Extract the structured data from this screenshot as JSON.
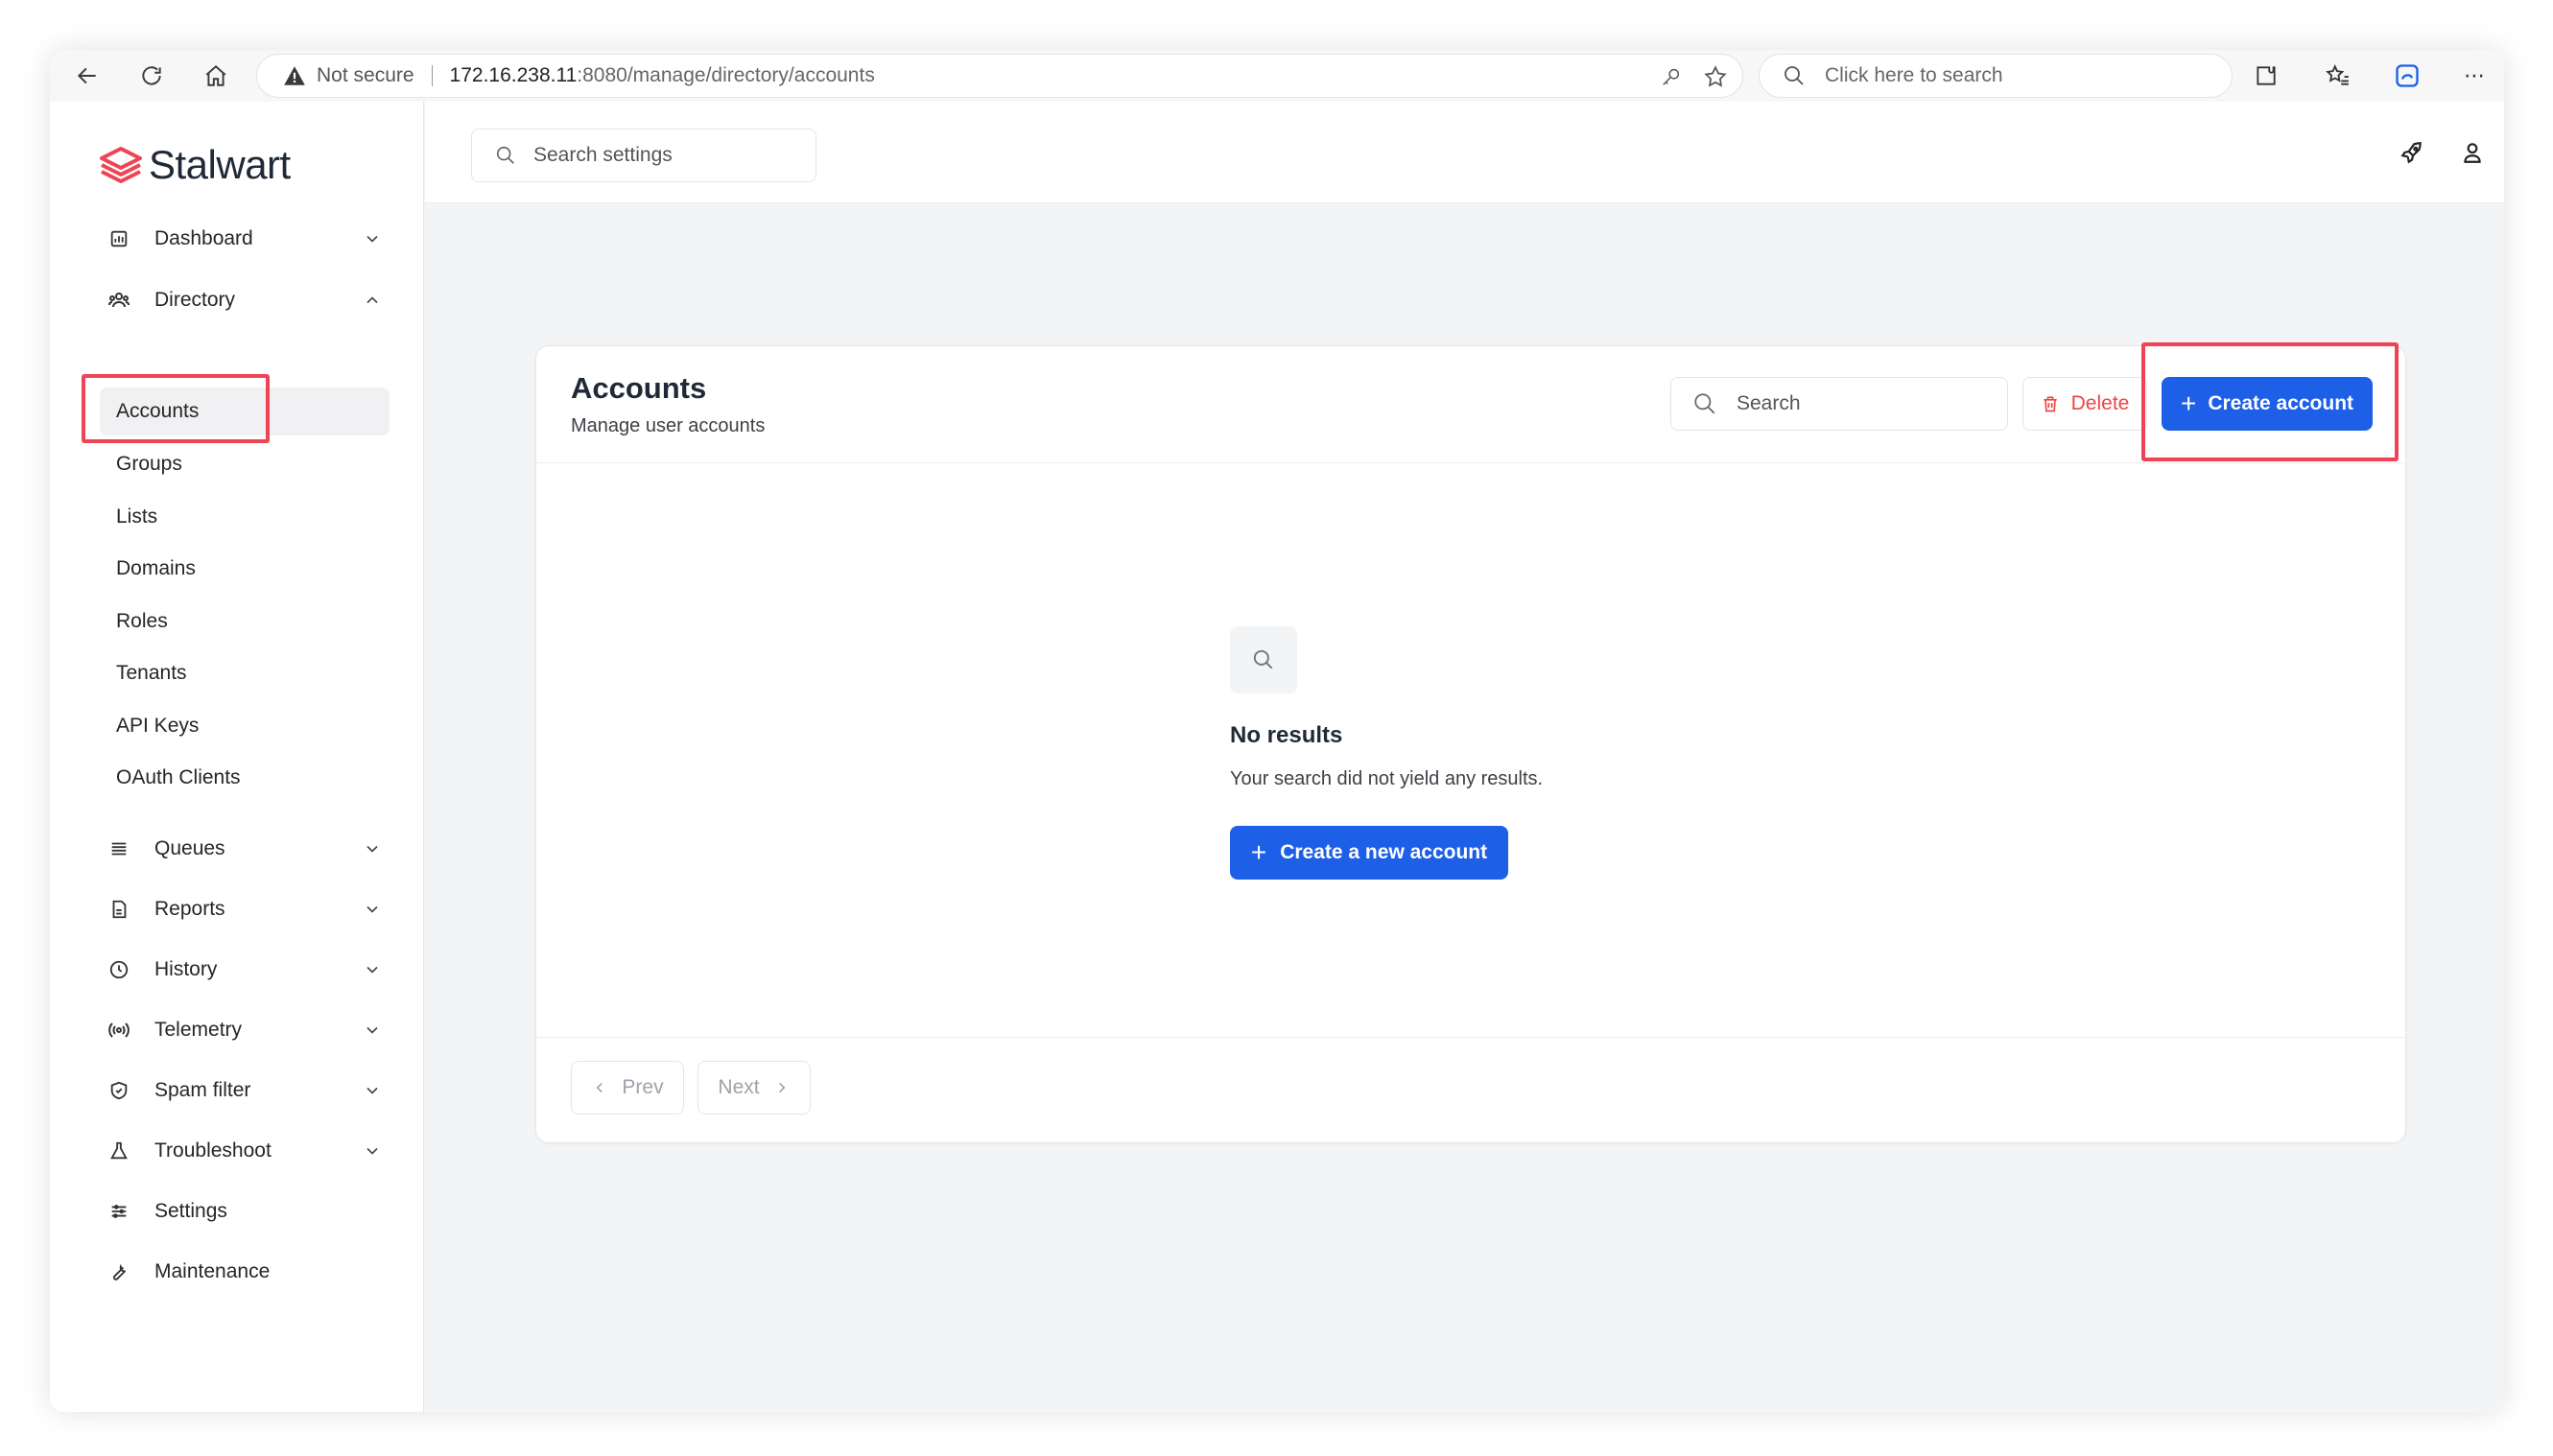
{
  "browser": {
    "security_label": "Not secure",
    "url_host": "172.16.238.11",
    "url_path": ":8080/manage/directory/accounts",
    "search_placeholder": "Click here to search"
  },
  "app": {
    "name": "Stalwart",
    "accent_color": "#ef4456",
    "primary_color": "#1d5fe6",
    "settings_search_placeholder": "Search settings"
  },
  "sidebar": {
    "items": [
      {
        "label": "Dashboard",
        "icon": "dashboard-icon"
      },
      {
        "label": "Directory",
        "icon": "directory-icon"
      },
      {
        "label": "Queues",
        "icon": "queues-icon"
      },
      {
        "label": "Reports",
        "icon": "reports-icon"
      },
      {
        "label": "History",
        "icon": "clock-icon"
      },
      {
        "label": "Telemetry",
        "icon": "telemetry-icon"
      },
      {
        "label": "Spam filter",
        "icon": "shield-icon"
      },
      {
        "label": "Troubleshoot",
        "icon": "flask-icon"
      },
      {
        "label": "Settings",
        "icon": "sliders-icon"
      },
      {
        "label": "Maintenance",
        "icon": "wrench-icon"
      }
    ],
    "directory_sub": [
      {
        "label": "Accounts",
        "active": true
      },
      {
        "label": "Groups"
      },
      {
        "label": "Lists"
      },
      {
        "label": "Domains"
      },
      {
        "label": "Roles"
      },
      {
        "label": "Tenants"
      },
      {
        "label": "API Keys"
      },
      {
        "label": "OAuth Clients"
      }
    ]
  },
  "main": {
    "title": "Accounts",
    "subtitle": "Manage user accounts",
    "search_placeholder": "Search",
    "delete_label": "Delete",
    "create_label": "Create account",
    "empty_title": "No results",
    "empty_subtitle": "Your search did not yield any results.",
    "empty_button_label": "Create a new account",
    "prev_label": "Prev",
    "next_label": "Next"
  }
}
